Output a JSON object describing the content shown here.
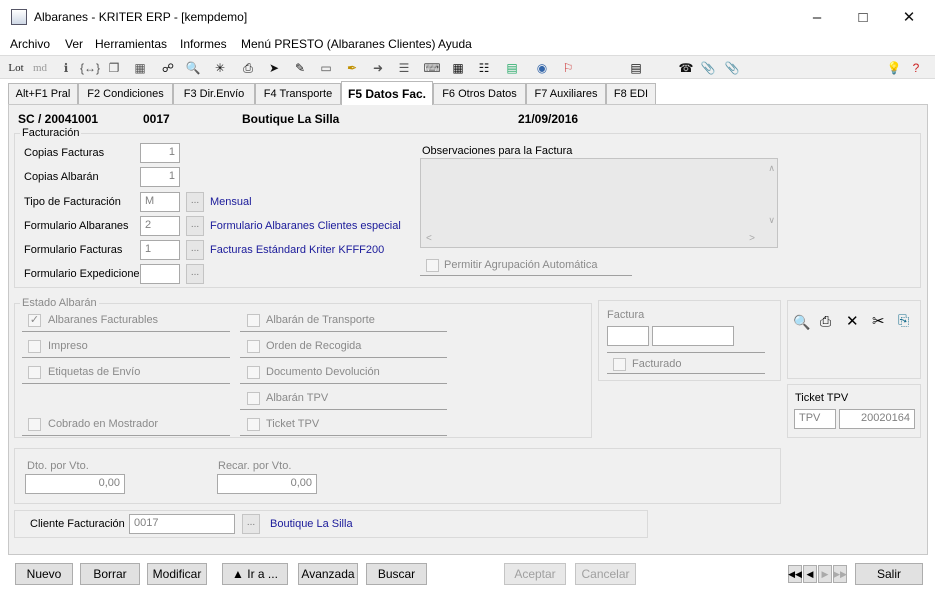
{
  "window": {
    "title": "Albaranes - KRITER ERP - [kempdemo]"
  },
  "menu": [
    "Archivo",
    "Ver",
    "Herramientas",
    "Informes",
    "Menú PRESTO (Albaranes Clientes)",
    "Ayuda"
  ],
  "toolbar": {
    "lot": "Lot",
    "md": "md"
  },
  "tabs": [
    "Alt+F1 Pral",
    "F2 Condiciones",
    "F3 Dir.Envío",
    "F4 Transporte",
    "F5 Datos Fac.",
    "F6 Otros Datos",
    "F7 Auxiliares",
    "F8 EDI"
  ],
  "header": {
    "doc": "SC / 20041001",
    "code": "0017",
    "client": "Boutique La Silla",
    "date": "21/09/2016"
  },
  "facturacion": {
    "title": "Facturación",
    "copias_facturas_label": "Copias Facturas",
    "copias_facturas": "1",
    "copias_albaran_label": "Copias Albarán",
    "copias_albaran": "1",
    "tipo_label": "Tipo de Facturación",
    "tipo": "M",
    "tipo_desc": "Mensual",
    "form_alb_label": "Formulario Albaranes",
    "form_alb": "2",
    "form_alb_desc": "Formulario Albaranes Clientes especial",
    "form_fac_label": "Formulario Facturas",
    "form_fac": "1",
    "form_fac_desc": "Facturas Estándard Kriter KFFF200",
    "form_exp_label": "Formulario Expediciones",
    "form_exp": "",
    "obs_label": "Observaciones para la Factura",
    "permitir": "Permitir Agrupación Automática",
    "dots": "..."
  },
  "estado": {
    "title": "Estado  Albarán",
    "albaranes_facturables": "Albaranes Facturables",
    "impreso": "Impreso",
    "etiquetas": "Etiquetas de Envío",
    "cobrado": "Cobrado en Mostrador",
    "albaran_transporte": "Albarán de Transporte",
    "orden_recogida": "Orden de Recogida",
    "documento_devolucion": "Documento Devolución",
    "albaran_tpv": "Albarán TPV",
    "ticket_tpv": "Ticket TPV"
  },
  "factura": {
    "title": "Factura",
    "facturado": "Facturado"
  },
  "ticket": {
    "title": "Ticket TPV",
    "tpv": "TPV",
    "number": "20020164"
  },
  "dto": {
    "dto_label": "Dto. por Vto.",
    "dto_value": "0,00",
    "recar_label": "Recar. por Vto.",
    "recar_value": "0,00"
  },
  "cliente": {
    "label": "Cliente Facturación",
    "code": "0017",
    "name": "Boutique La Silla",
    "dots": "..."
  },
  "buttons": {
    "nuevo": "Nuevo",
    "borrar": "Borrar",
    "modificar": "Modificar",
    "ira": "▲ Ir a ...",
    "avanzada": "Avanzada",
    "buscar": "Buscar",
    "aceptar": "Aceptar",
    "cancelar": "Cancelar",
    "salir": "Salir"
  }
}
